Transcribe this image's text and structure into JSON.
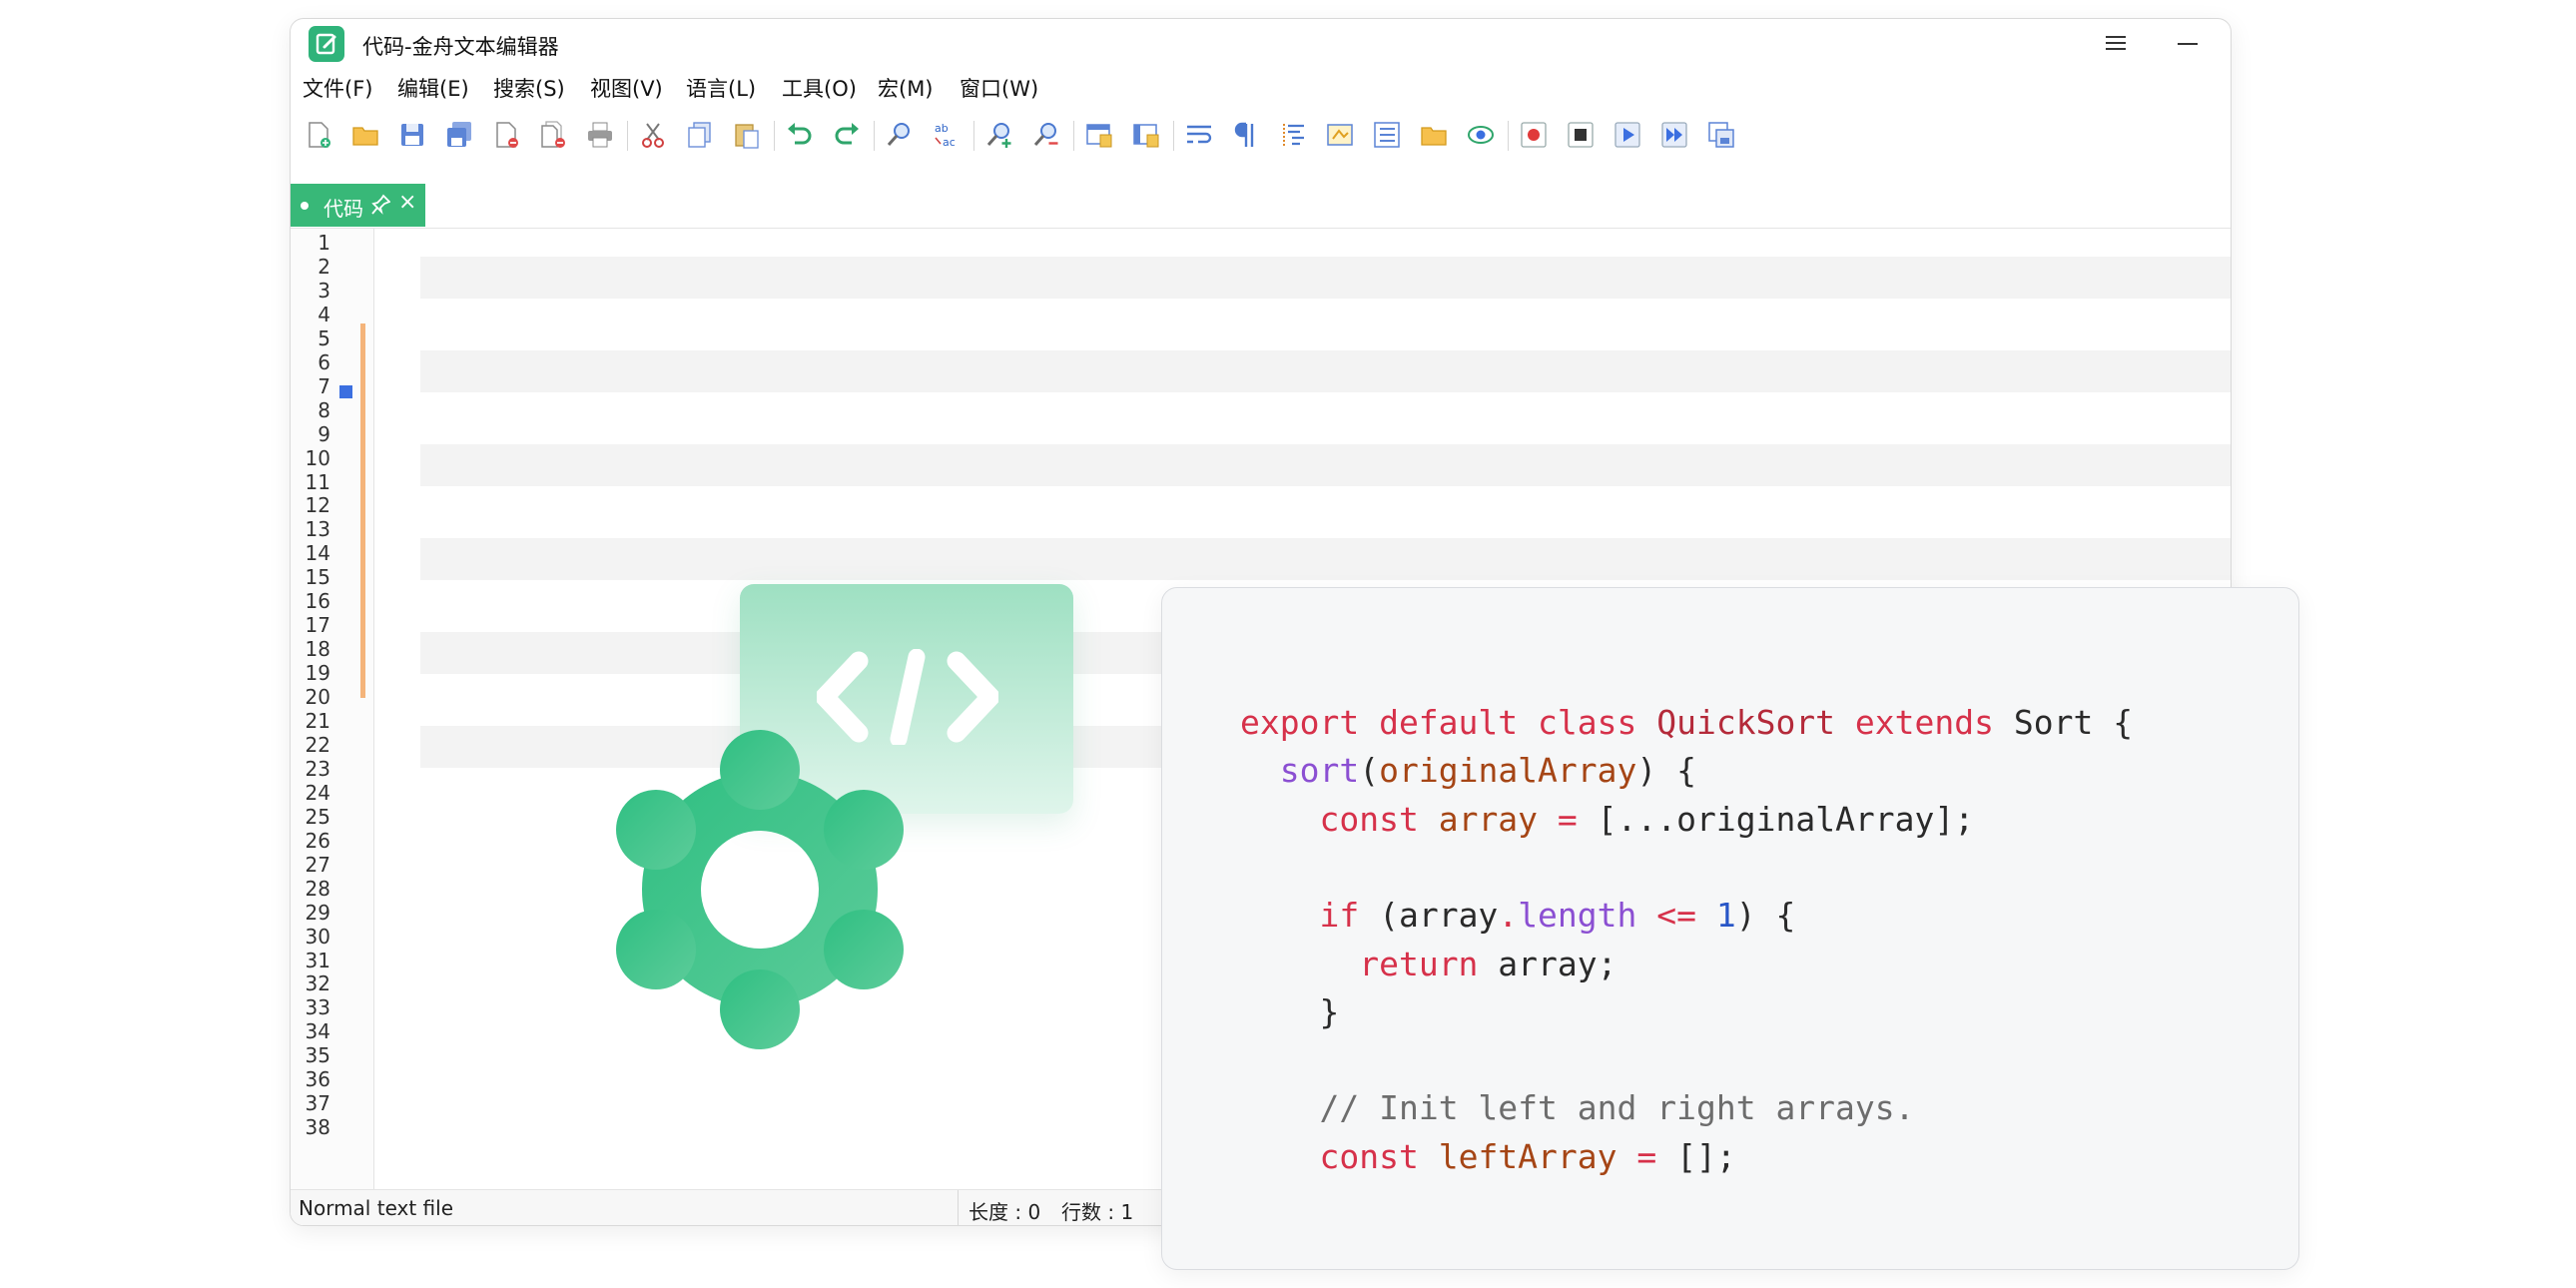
{
  "window": {
    "title": "代码-金舟文本编辑器",
    "controls": {
      "menu": "menu",
      "minimize": "minimize",
      "maximize": "maximize",
      "close": "close"
    }
  },
  "menubar": {
    "items": [
      {
        "label": "文件(F)"
      },
      {
        "label": "编辑(E)"
      },
      {
        "label": "搜索(S)"
      },
      {
        "label": "视图(V)"
      },
      {
        "label": "语言(L)"
      },
      {
        "label": "工具(O)"
      },
      {
        "label": "宏(M)"
      },
      {
        "label": "窗口(W)"
      }
    ]
  },
  "toolbar": {
    "icons": [
      "new-file-icon",
      "open-file-icon",
      "save-icon",
      "save-all-icon",
      "close-icon",
      "close-all-icon",
      "print-icon",
      "cut-icon",
      "copy-icon",
      "paste-icon",
      "undo-icon",
      "redo-icon",
      "find-icon",
      "replace-icon",
      "zoom-in-icon",
      "zoom-out-icon",
      "sync-vertical-icon",
      "sync-horizontal-icon",
      "word-wrap-icon",
      "show-all-characters-icon",
      "indent-guide-icon",
      "document-map-icon",
      "function-list-icon",
      "folder-workspace-icon",
      "monitoring-icon",
      "record-macro-icon",
      "stop-recording-icon",
      "playback-macro-icon",
      "run-macro-multiple-icon",
      "save-macro-icon"
    ]
  },
  "tabs": [
    {
      "label": "代码",
      "close": "×"
    }
  ],
  "editor": {
    "line_numbers": [
      "1",
      "2",
      "3",
      "4",
      "5",
      "6",
      "7",
      "8",
      "9",
      "10",
      "11",
      "12",
      "13",
      "14",
      "15",
      "16",
      "17",
      "18",
      "19",
      "20",
      "21",
      "22",
      "23",
      "24",
      "25",
      "26",
      "27",
      "28",
      "29",
      "30",
      "31",
      "32",
      "33",
      "34",
      "35",
      "36",
      "37",
      "38"
    ]
  },
  "statusbar": {
    "file_type": "Normal text file",
    "length": "长度 : 0",
    "lines": "行数 : 1"
  },
  "code_card": {
    "lines": [
      [
        {
          "t": "export default class ",
          "c": "kw"
        },
        {
          "t": "QuickSort",
          "c": "cls"
        },
        {
          "t": " extends ",
          "c": "kw"
        },
        {
          "t": "Sort {",
          "c": "pl"
        }
      ],
      [
        {
          "t": "  ",
          "c": "pl"
        },
        {
          "t": "sort",
          "c": "fn"
        },
        {
          "t": "(",
          "c": "pl"
        },
        {
          "t": "originalArray",
          "c": "var"
        },
        {
          "t": ") {",
          "c": "pl"
        }
      ],
      [
        {
          "t": "    ",
          "c": "pl"
        },
        {
          "t": "const ",
          "c": "kw"
        },
        {
          "t": "array",
          "c": "var"
        },
        {
          "t": " = ",
          "c": "kw"
        },
        {
          "t": "[...originalArray];",
          "c": "pl"
        }
      ],
      [],
      [
        {
          "t": "    ",
          "c": "pl"
        },
        {
          "t": "if ",
          "c": "kw"
        },
        {
          "t": "(array",
          "c": "pl"
        },
        {
          "t": ".",
          "c": "kw"
        },
        {
          "t": "length",
          "c": "fn"
        },
        {
          "t": " <= ",
          "c": "kw"
        },
        {
          "t": "1",
          "c": "num"
        },
        {
          "t": ") {",
          "c": "pl"
        }
      ],
      [
        {
          "t": "      ",
          "c": "pl"
        },
        {
          "t": "return ",
          "c": "kw"
        },
        {
          "t": "array;",
          "c": "pl"
        }
      ],
      [
        {
          "t": "    }",
          "c": "pl"
        }
      ],
      [],
      [
        {
          "t": "    ",
          "c": "pl"
        },
        {
          "t": "// Init left and right arrays.",
          "c": "cmt"
        }
      ],
      [
        {
          "t": "    ",
          "c": "pl"
        },
        {
          "t": "const ",
          "c": "kw"
        },
        {
          "t": "leftArray",
          "c": "var"
        },
        {
          "t": " = ",
          "c": "kw"
        },
        {
          "t": "[];",
          "c": "pl"
        }
      ]
    ]
  },
  "colors": {
    "accent": "#38b878",
    "change_marker": "#f4b47a",
    "bookmark": "#3b6fe0",
    "keyword": "#d6314a",
    "function": "#8b4fd2"
  }
}
